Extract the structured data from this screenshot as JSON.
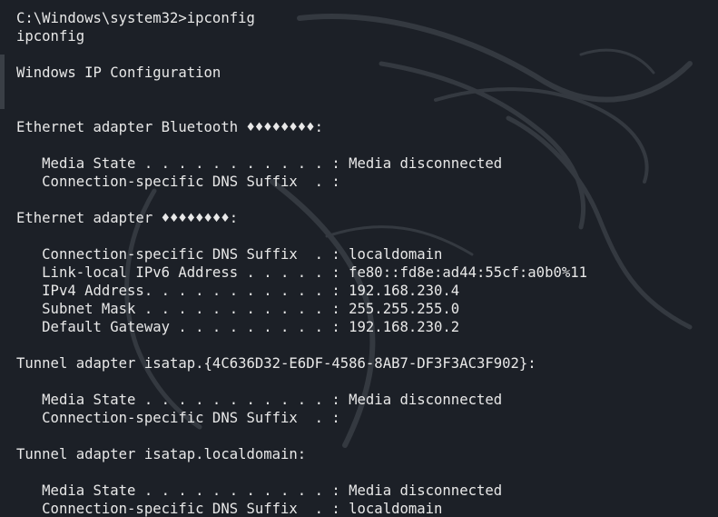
{
  "terminal": {
    "lines": [
      "C:\\Windows\\system32>ipconfig",
      "ipconfig",
      "",
      "Windows IP Configuration",
      "",
      "",
      "Ethernet adapter Bluetooth ♦♦♦♦♦♦♦♦:",
      "",
      "   Media State . . . . . . . . . . . : Media disconnected",
      "   Connection-specific DNS Suffix  . :",
      "",
      "Ethernet adapter ♦♦♦♦♦♦♦♦:",
      "",
      "   Connection-specific DNS Suffix  . : localdomain",
      "   Link-local IPv6 Address . . . . . : fe80::fd8e:ad44:55cf:a0b0%11",
      "   IPv4 Address. . . . . . . . . . . : 192.168.230.4",
      "   Subnet Mask . . . . . . . . . . . : 255.255.255.0",
      "   Default Gateway . . . . . . . . . : 192.168.230.2",
      "",
      "Tunnel adapter isatap.{4C636D32-E6DF-4586-8AB7-DF3F3AC3F902}:",
      "",
      "   Media State . . . . . . . . . . . : Media disconnected",
      "   Connection-specific DNS Suffix  . :",
      "",
      "Tunnel adapter isatap.localdomain:",
      "",
      "   Media State . . . . . . . . . . . : Media disconnected",
      "   Connection-specific DNS Suffix  . : localdomain"
    ]
  },
  "colors": {
    "background": "#1c2027",
    "text": "#e8e8e8",
    "wallpaper_stroke": "#3b4148"
  }
}
